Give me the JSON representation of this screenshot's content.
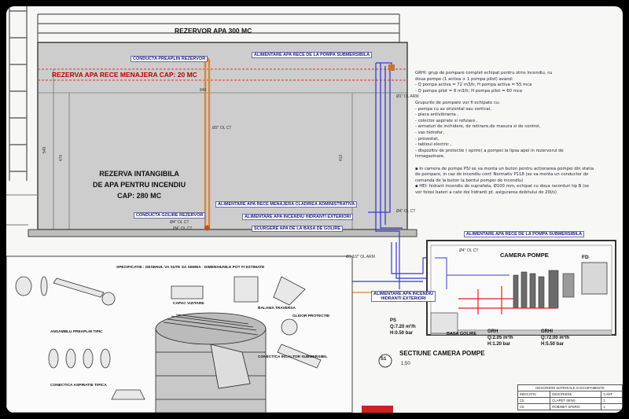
{
  "titles": {
    "reservoir": "REZERVOR APA 300 MC",
    "cold_water_reserve": "REZERVA APA RECE MENAJERA CAP: 20 MC",
    "fire_reserve": [
      "REZERVA INTANGIBILA",
      "DE APA PENTRU INCENDIU",
      "CAP: 280 MC"
    ],
    "section": "SECTIUNE CAMERA POMPE",
    "section_scale": "1:50",
    "section_marker": "S1",
    "pump_room": "CAMERA POMPE",
    "fd": "FD"
  },
  "callouts": {
    "overflow_pipe": "CONDUCTA PREAPLIN REZERVOR",
    "drain_pipe": "CONDUCTA GOLIRE REZERVOR",
    "cold_water_submersible": "ALIMENTARE APA RECE DE LA POMPA SUBMERSIBILA",
    "admin_building": "ALIMENTARE APA RECE MENAJERA CLADIREA ADMINISTRATIVA",
    "fire_hydrants": "ALIMENTARE APA INCENDIU HIDRANTI EXTERIORI",
    "drain_basin": "SCURGERE APA DE LA BASA DE GOLIRE",
    "cold_water_submersible_2": "ALIMENTARE APA RECE DE LA POMPA SUBMERSIBILA",
    "hydrants_ext": [
      "ALIMENTARE APA INCENDIU",
      "HIDRANTI EXTERIORI"
    ]
  },
  "dims": {
    "d1": "Ø1\" OL ARM",
    "d2": "Ø3\" OL CT",
    "d3": "Ø4\" OL CT",
    "d4": "Ø4\" OL CT",
    "d5": "Ø4\" OL CT",
    "d6": "Ø1 1/2\" OL ARM",
    "d7": "Ø4\" OL CT",
    "h1": "840",
    "h2": "413",
    "h3": "549",
    "h4": "470"
  },
  "pumps": {
    "ps": [
      "PS",
      "Q:7.20 m³/h",
      "H:0.50 bar"
    ],
    "grh": [
      "GRH",
      "Q:2.05 m³/h",
      "H:1.20 bar"
    ],
    "grhi": [
      "GRHI",
      "Q:72.00 m³/h",
      "H:5.50 bar"
    ],
    "basa": "BASA GOLIRE"
  },
  "notes": [
    "GRHI: grup de pompare complet echipat pentru stins incendiu, cu",
    "doua pompe (1 activa + 1 pompa pilot) avand:",
    "- Q pompa activa = 72 m3/h; H pompa activa = 55 mca",
    "- Q pompa pilot = 8 m3/h; H pompa pilot = 60 mca",
    "",
    "Grupurile de pompare vor fi echipate cu:",
    "- pompa cu ax orizontal sau vertical,",
    "- placa antivibranta ,",
    "- colector aspirate si refulare ,",
    "- armaturi de inchidere, de retinere,de masura si de control,",
    "- vas hidrofor,",
    "- presostat,",
    "- tabloul electric ,",
    "- dispozitiv de protectie ( oprire) a pompei la lipsa apei in rezervorul de",
    "  inmagazinare.",
    "",
    "▪ In camera de pompe PSI se va monta un buton pentru actionarea pompei din statia",
    "  de pompare, in caz de incendiu conf. Normativ P118 (se va monta un conductor de",
    "  comanda de la buton la bordul pompei de incendiu)",
    "▪ HEI: hidrant incendiu de suprafata, Ø100 mm, echipat cu doua racorduri tip B (se",
    "  vor folosi bateri a cate doi hidranti pt. asigurarea debitului de 20l/s)"
  ],
  "detail": {
    "title": "SPECIFICATIE : DESENUL VA SUTE SA SEMNA - DIMENSIUNILE POT FI ESTIMATE",
    "preaplin": "ANSAMBLU PREAPLIN TIPIC",
    "aspirare": "CONECTICA ASPIRATIE TIPICA",
    "submersibil": "CONECTICA INCALTOR SUBMERSIBIL",
    "capac": "CAPAC VIZITARE",
    "balama": "BALAMA TRAVERSA",
    "glisor": "GLISOR PROTECTIE"
  },
  "table": {
    "header": "DESCRIERE MATERIALE SI ECHIPAMENTE",
    "columns": [
      "INDICATIV",
      "DESCRIERE",
      "CANT"
    ],
    "rows": [
      [
        "C5",
        "CLAPET SENS",
        "1"
      ],
      [
        "C5",
        "ROBINET SFERIC",
        "1"
      ]
    ]
  },
  "colors": {
    "reservoir_fill": "#cdcdcd",
    "pipe_orange": "#d9863a",
    "pipe_blue": "#3a3ad0",
    "red_line": "#e33333",
    "callout_text": "#1a1a7a"
  }
}
